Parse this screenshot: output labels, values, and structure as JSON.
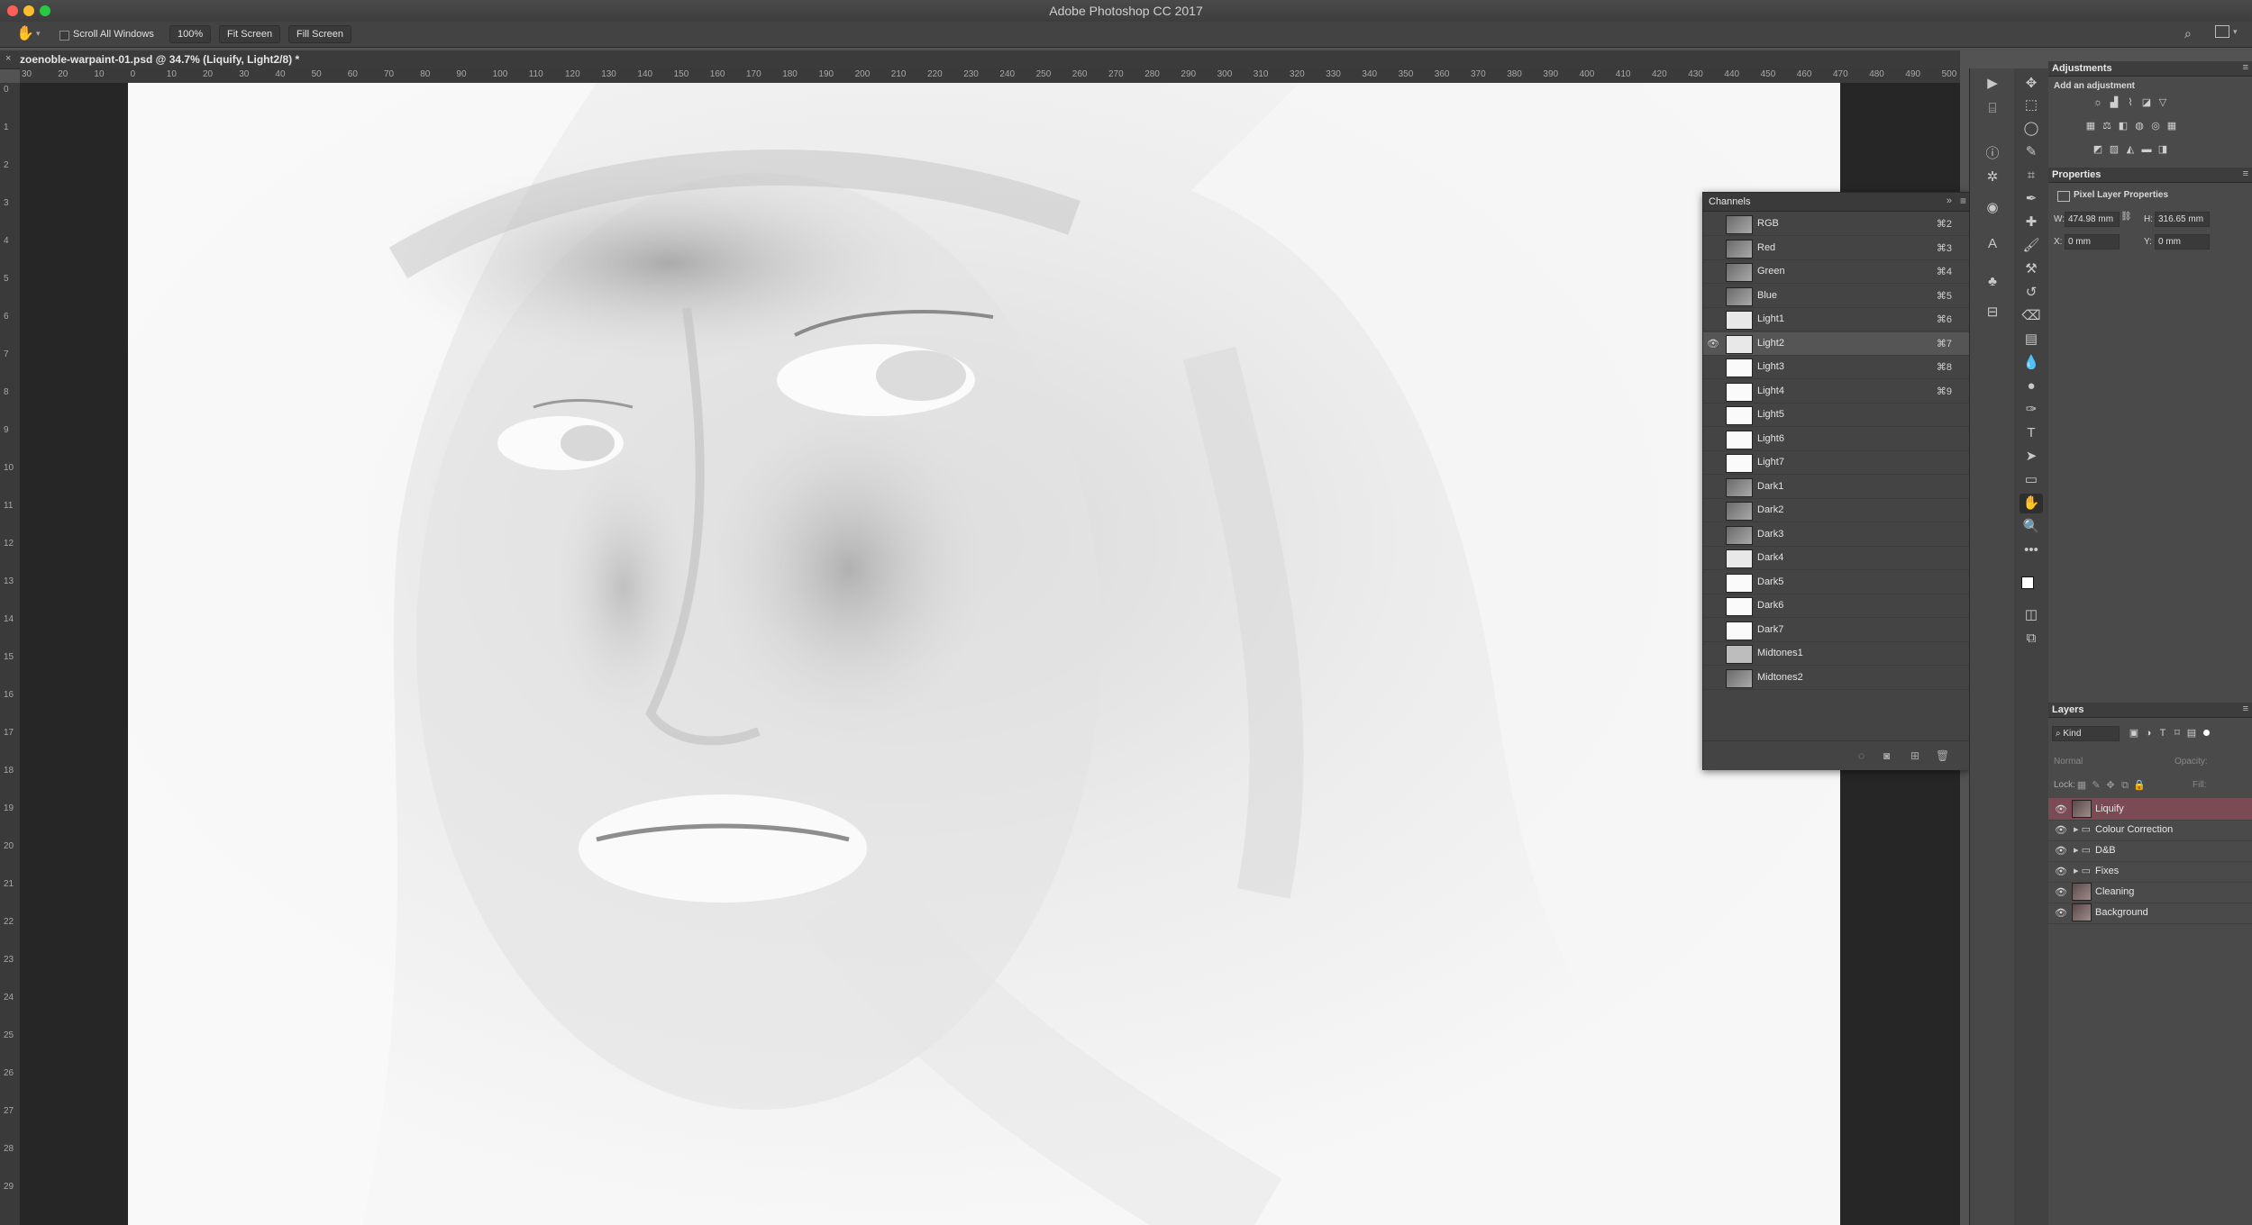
{
  "window": {
    "title": "Adobe Photoshop CC 2017"
  },
  "options_bar": {
    "scroll_all_windows": "Scroll All Windows",
    "zoom_100": "100%",
    "fit_screen": "Fit Screen",
    "fill_screen": "Fill Screen"
  },
  "document": {
    "tab_title": "zoenoble-warpaint-01.psd @ 34.7% (Liquify, Light2/8) *"
  },
  "ruler": {
    "horizontal": [
      "30",
      "20",
      "10",
      "0",
      "10",
      "20",
      "30",
      "40",
      "50",
      "60",
      "70",
      "80",
      "90",
      "100",
      "110",
      "120",
      "130",
      "140",
      "150",
      "160",
      "170",
      "180",
      "190",
      "200",
      "210",
      "220",
      "230",
      "240",
      "250",
      "260",
      "270",
      "280",
      "290",
      "300",
      "310",
      "320",
      "330",
      "340",
      "350",
      "360",
      "370",
      "380",
      "390",
      "400",
      "410",
      "420",
      "430",
      "440",
      "450",
      "460",
      "470",
      "480",
      "490",
      "500"
    ],
    "vertical": [
      "0",
      "1",
      "2",
      "3",
      "4",
      "5",
      "6",
      "7",
      "8",
      "9",
      "10",
      "11",
      "12",
      "13",
      "14",
      "15",
      "16",
      "17",
      "18",
      "19",
      "20",
      "21",
      "22",
      "23",
      "24",
      "25",
      "26",
      "27",
      "28",
      "29"
    ]
  },
  "channels": {
    "title": "Channels",
    "items": [
      {
        "name": "RGB",
        "shortcut": "⌘2",
        "thumb": "color"
      },
      {
        "name": "Red",
        "shortcut": "⌘3",
        "thumb": "color"
      },
      {
        "name": "Green",
        "shortcut": "⌘4",
        "thumb": "color"
      },
      {
        "name": "Blue",
        "shortcut": "⌘5",
        "thumb": "color"
      },
      {
        "name": "Light1",
        "shortcut": "⌘6",
        "thumb": "light"
      },
      {
        "name": "Light2",
        "shortcut": "⌘7",
        "thumb": "light",
        "visible": true,
        "selected": true
      },
      {
        "name": "Light3",
        "shortcut": "⌘8",
        "thumb": "white"
      },
      {
        "name": "Light4",
        "shortcut": "⌘9",
        "thumb": "white"
      },
      {
        "name": "Light5",
        "shortcut": "",
        "thumb": "white"
      },
      {
        "name": "Light6",
        "shortcut": "",
        "thumb": "white"
      },
      {
        "name": "Light7",
        "shortcut": "",
        "thumb": "white"
      },
      {
        "name": "Dark1",
        "shortcut": "",
        "thumb": "color"
      },
      {
        "name": "Dark2",
        "shortcut": "",
        "thumb": "color"
      },
      {
        "name": "Dark3",
        "shortcut": "",
        "thumb": "color"
      },
      {
        "name": "Dark4",
        "shortcut": "",
        "thumb": "light"
      },
      {
        "name": "Dark5",
        "shortcut": "",
        "thumb": "white"
      },
      {
        "name": "Dark6",
        "shortcut": "",
        "thumb": "white"
      },
      {
        "name": "Dark7",
        "shortcut": "",
        "thumb": "white"
      },
      {
        "name": "Midtones1",
        "shortcut": "",
        "thumb": "mid"
      },
      {
        "name": "Midtones2",
        "shortcut": "",
        "thumb": "color"
      }
    ],
    "footer_icons": [
      "load-selection-icon",
      "save-selection-icon",
      "new-channel-icon",
      "delete-channel-icon"
    ]
  },
  "adjustments": {
    "title": "Adjustments",
    "subtitle": "Add an adjustment"
  },
  "properties": {
    "title": "Properties",
    "subtitle": "Pixel Layer Properties",
    "w_label": "W:",
    "w_value": "474.98 mm",
    "h_label": "H:",
    "h_value": "316.65 mm",
    "x_label": "X:",
    "x_value": "0 mm",
    "y_label": "Y:",
    "y_value": "0 mm"
  },
  "layers": {
    "title": "Layers",
    "filter_kind": "Kind",
    "blend_mode": "Normal",
    "opacity_label": "Opacity:",
    "lock_label": "Lock:",
    "fill_label": "Fill:",
    "items": [
      {
        "name": "Liquify",
        "type": "pixel",
        "selected": true
      },
      {
        "name": "Colour Correction",
        "type": "group"
      },
      {
        "name": "D&B",
        "type": "group"
      },
      {
        "name": "Fixes",
        "type": "group"
      },
      {
        "name": "Cleaning",
        "type": "pixel"
      },
      {
        "name": "Background",
        "type": "pixel"
      }
    ]
  },
  "colors": {
    "accent_selected_layer": "#7a4a55",
    "traffic_close": "#ff5f57",
    "traffic_min": "#febc2e",
    "traffic_max": "#28c840"
  }
}
